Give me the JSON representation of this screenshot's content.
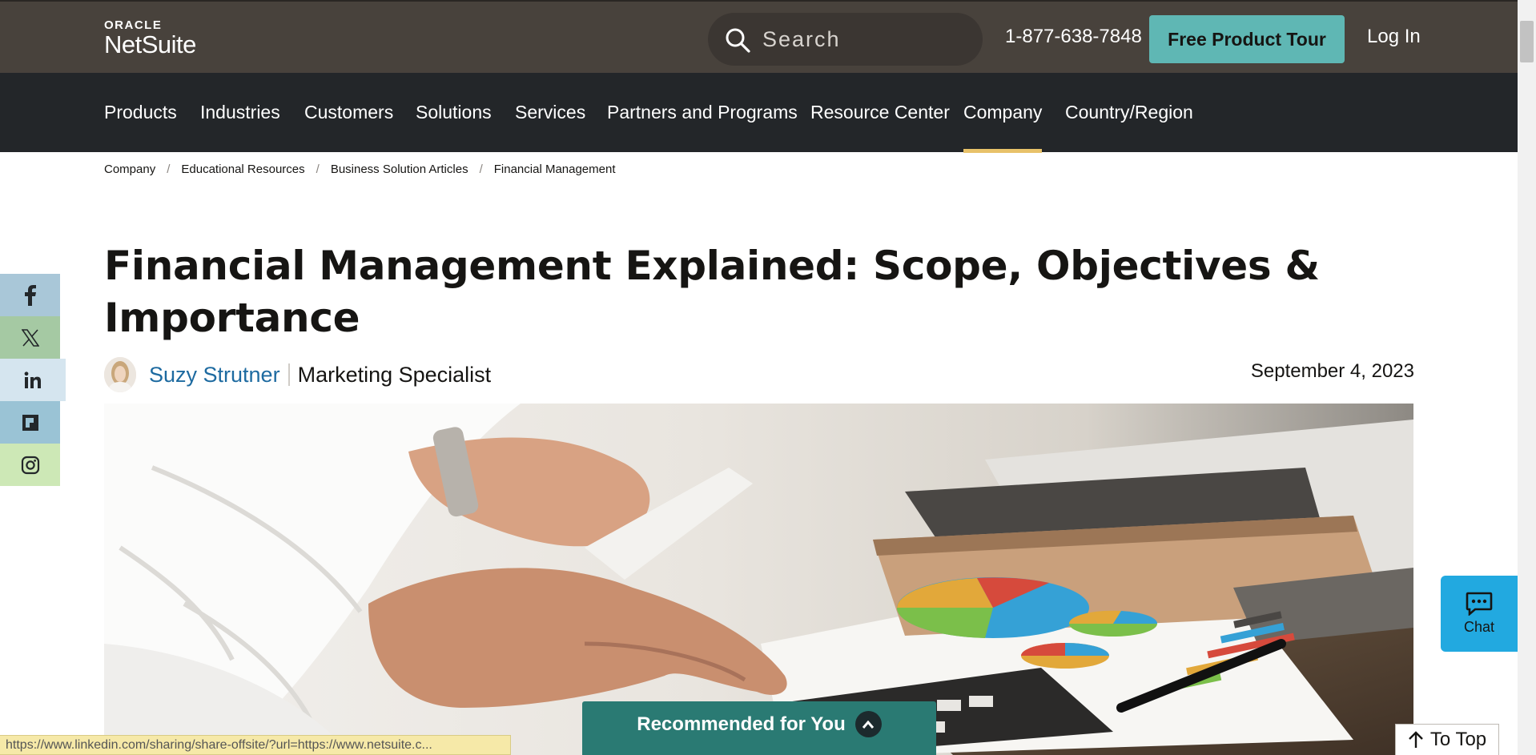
{
  "header": {
    "logo_top": "ORACLE",
    "logo_bottom": "NetSuite",
    "search_placeholder": "Search",
    "phone": "1-877-638-7848",
    "tour_button": "Free Product Tour",
    "login": "Log In"
  },
  "nav": {
    "items": [
      "Products",
      "Industries",
      "Customers",
      "Solutions",
      "Services",
      "Partners and Programs",
      "Resource Center",
      "Company",
      "Country/Region"
    ],
    "active": "Company"
  },
  "breadcrumb": {
    "items": [
      "Company",
      "Educational Resources",
      "Business Solution Articles",
      "Financial Management"
    ],
    "separator": "/"
  },
  "social": [
    "facebook-icon",
    "x-icon",
    "linkedin-icon",
    "flipboard-icon",
    "instagram-icon"
  ],
  "article": {
    "title_line1": "Financial Management Explained: Scope, Objectives &",
    "title_line2": "Importance",
    "author": "Suzy Strutner",
    "role": "Marketing Specialist",
    "date": "September 4, 2023"
  },
  "widgets": {
    "chat": "Chat",
    "recommended": "Recommended for You",
    "to_top": "To Top",
    "status_url": "https://www.linkedin.com/sharing/share-offsite/?url=https://www.netsuite.c..."
  },
  "colors": {
    "header_bg": "#48423c",
    "nav_bg": "#232629",
    "tour_button": "#5fb7b4",
    "active_underline": "#e8c26a",
    "author_link": "#1d6aa0",
    "chat_bg": "#22a9e0",
    "recommend_bg": "#2a7a73"
  }
}
